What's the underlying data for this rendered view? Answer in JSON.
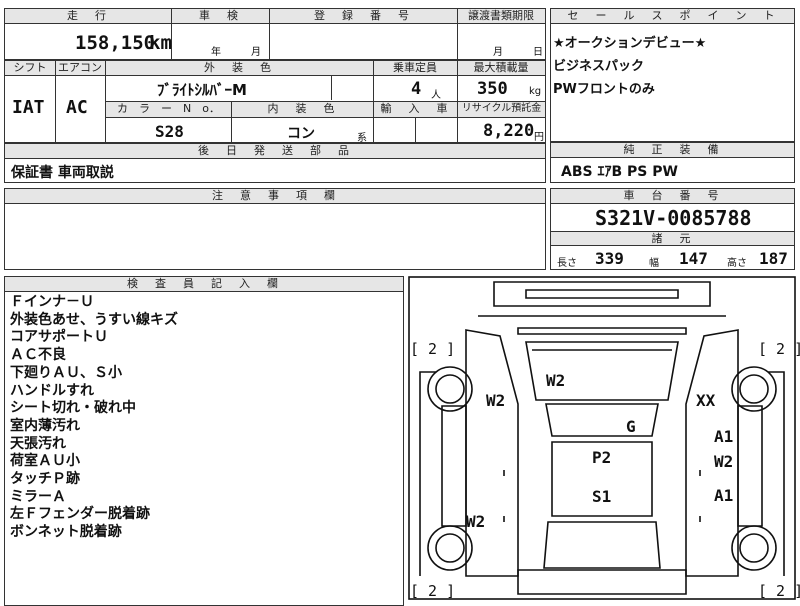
{
  "top": {
    "mileage_header": "走　行",
    "mileage_value": "158,150",
    "mileage_unit": "km",
    "inspection_header": "車　検",
    "inspection_year": "年",
    "inspection_month": "月",
    "registration_header": "登　録　番　号",
    "transfer_header": "譲渡書類期限",
    "transfer_month": "月",
    "transfer_day": "日"
  },
  "row2": {
    "shift_header": "シフト",
    "shift_value": "IAT",
    "aircon_header": "エアコン",
    "aircon_value": "AC",
    "exterior_header": "外　装　色",
    "exterior_value": "ﾌﾞﾗｲﾄｼﾙﾊﾞｰM",
    "capacity_header": "乗車定員",
    "capacity_value": "4",
    "capacity_unit": "人",
    "load_header": "最大積載量",
    "load_value": "350",
    "load_unit": "kg",
    "color_no_header": "カ　ラ　ー　N　o．",
    "color_no_value": "S28",
    "interior_header": "内　装　色",
    "interior_value": "コン",
    "interior_suffix": "系",
    "import_header": "輸　入　車",
    "recycle_header": "リサイクル預託金",
    "recycle_value": "8,220",
    "recycle_unit": "円"
  },
  "parts": {
    "header": "後　日　発　送　部　品",
    "value": "保証書 車両取説"
  },
  "caution": {
    "header": "注　意　事　項　欄"
  },
  "sales": {
    "header": "セ　ー　ル　ス　ポ　イ　ン　ト",
    "lines": [
      "★オークションデビュー★",
      "ビジネスパック",
      "PWフロントのみ"
    ]
  },
  "equipment": {
    "header": "純　正　装　備",
    "value": "ABS ｴｱB PS PW"
  },
  "chassis": {
    "header": "車　台　番　号",
    "value": "S321V-0085788",
    "specs_header": "諸　元",
    "length_label": "長さ",
    "length_value": "339",
    "width_label": "幅",
    "width_value": "147",
    "height_label": "高さ",
    "height_value": "187"
  },
  "inspector": {
    "header": "検　査　員　記　入　欄",
    "notes": [
      "Ｆインナ－Ｕ",
      "外装色あせ、うすい線キズ",
      "コアサポートＵ",
      "ＡＣ不良",
      "下廻りＡＵ、Ｓ小",
      "ハンドルすれ",
      "シート切れ・破れ中",
      "室内薄汚れ",
      "天張汚れ",
      "荷室ＡＵ小",
      "タッチＰ跡",
      "ミラーＡ",
      "左Ｆフェンダー脱着跡",
      "ボンネット脱着跡"
    ]
  },
  "diagram": {
    "tire_left_top": "[ 2 ]",
    "tire_right_top": "[ 2 ]",
    "tire_left_bottom": "[ 2 ]",
    "tire_right_bottom": "[ 2 ]",
    "marks": {
      "hood": "W2",
      "left_front": "W2",
      "right_front": "XX",
      "windshield": "G",
      "right_front_door_1": "A1",
      "right_front_door_2": "W2",
      "roof": "P2",
      "rear_roof": "S1",
      "right_rear_door": "A1",
      "left_rear_door": "W2"
    }
  }
}
